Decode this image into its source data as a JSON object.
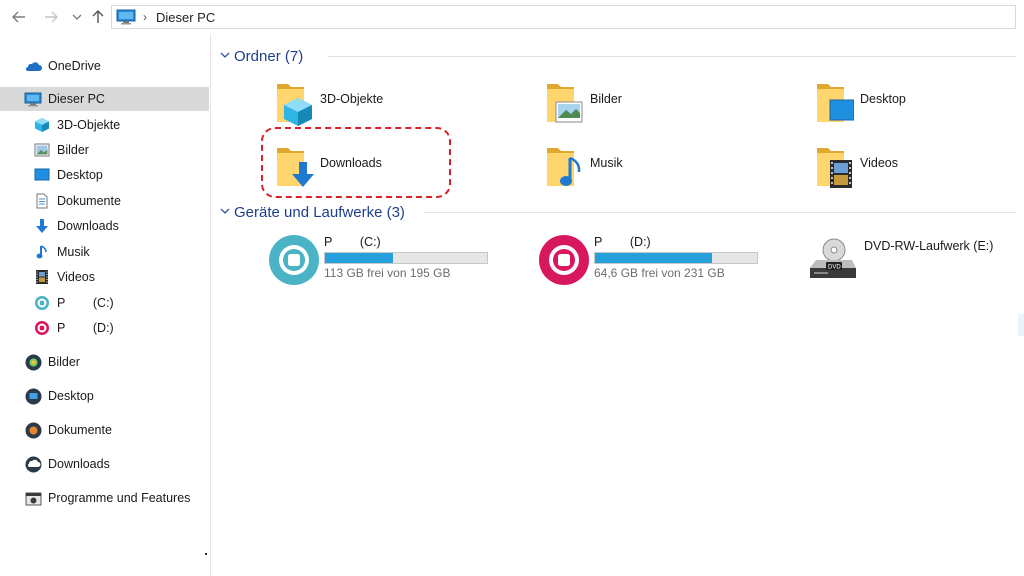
{
  "nav": {
    "back_icon": "arrow-left-icon",
    "forward_icon": "arrow-right-icon",
    "recent_icon": "chevron-down-icon",
    "up_icon": "arrow-up-icon"
  },
  "address": {
    "location_icon": "monitor-icon",
    "path": "Dieser PC"
  },
  "sidebar": {
    "items": [
      {
        "label": "OneDrive",
        "icon": "cloud-icon"
      },
      {
        "label": "Dieser PC",
        "icon": "monitor-icon",
        "selected": true
      },
      {
        "label": "3D-Objekte",
        "icon": "cube-icon"
      },
      {
        "label": "Bilder",
        "icon": "picture-icon"
      },
      {
        "label": "Desktop",
        "icon": "desktop-icon"
      },
      {
        "label": "Dokumente",
        "icon": "document-icon"
      },
      {
        "label": "Downloads",
        "icon": "download-arrow-icon"
      },
      {
        "label": "Musik",
        "icon": "music-note-icon"
      },
      {
        "label": "Videos",
        "icon": "film-icon"
      },
      {
        "label": "P        (C:)",
        "icon": "drive-c-icon"
      },
      {
        "label": "P        (D:)",
        "icon": "drive-d-icon"
      },
      {
        "label": "Bilder",
        "icon": "round-app-icon"
      },
      {
        "label": "Desktop",
        "icon": "round-app-icon"
      },
      {
        "label": "Dokumente",
        "icon": "round-app-icon"
      },
      {
        "label": "Downloads",
        "icon": "round-app-icon"
      },
      {
        "label": "Programme und Features",
        "icon": "control-panel-icon"
      }
    ]
  },
  "folders": {
    "header": "Ordner (7)",
    "items": [
      {
        "label": "3D-Objekte",
        "icon": "folder-3d-icon"
      },
      {
        "label": "Bilder",
        "icon": "folder-pictures-icon"
      },
      {
        "label": "Desktop",
        "icon": "folder-desktop-icon"
      },
      {
        "label": "Downloads",
        "icon": "folder-downloads-icon"
      },
      {
        "label": "Musik",
        "icon": "folder-music-icon"
      },
      {
        "label": "Videos",
        "icon": "folder-videos-icon"
      }
    ]
  },
  "drives": {
    "header": "Geräte und Laufwerke (3)",
    "items": [
      {
        "label": "P        (C:)",
        "free": "113 GB frei von 195 GB",
        "used_fraction": 0.42,
        "color": "#4bb3c6"
      },
      {
        "label": "P        (D:)",
        "free": "64,6 GB frei von 231 GB",
        "used_fraction": 0.72,
        "color": "#d8185e"
      },
      {
        "label": "DVD-RW-Laufwerk (E:)",
        "icon": "dvd-drive-icon"
      }
    ]
  },
  "colors": {
    "accent": "#1e3f8f",
    "bar_fill": "#26a0da",
    "highlight": "#d62128",
    "selected_bg": "#d9d9d9"
  }
}
